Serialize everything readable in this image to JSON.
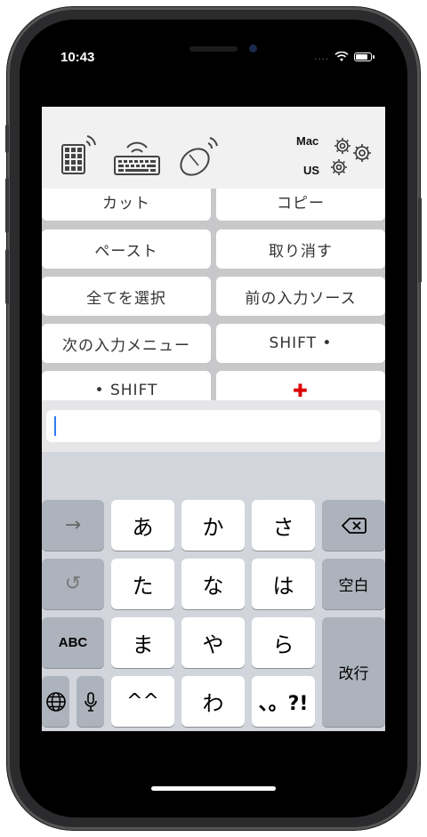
{
  "status_bar": {
    "time": "10:43",
    "signal": "...."
  },
  "toolbar": {
    "icons": [
      "wireless-numpad-icon",
      "wireless-keyboard-icon",
      "wireless-mouse-icon",
      "gears-icon"
    ],
    "mac_label": "Mac",
    "us_label": "US"
  },
  "macros": [
    "カット",
    "コピー",
    "ペースト",
    "取り消す",
    "全てを選択",
    "前の入力ソース",
    "次の入力メニュー",
    "SHIFT •",
    "• SHIFT",
    "✚"
  ],
  "input": {
    "value": ""
  },
  "keyboard": {
    "arrow": "→",
    "undo": "↺",
    "abc": "ABC",
    "kana": [
      "あ",
      "か",
      "さ",
      "た",
      "な",
      "は",
      "ま",
      "や",
      "ら",
      "^^",
      "わ",
      "、。?!"
    ],
    "backspace": "⌫",
    "space": "空白",
    "return": "改行",
    "globe": "🌐",
    "mic": "mic"
  },
  "colors": {
    "accent": "#d00000",
    "caret": "#2f7bf6",
    "key_gray": "#adb3bc"
  }
}
